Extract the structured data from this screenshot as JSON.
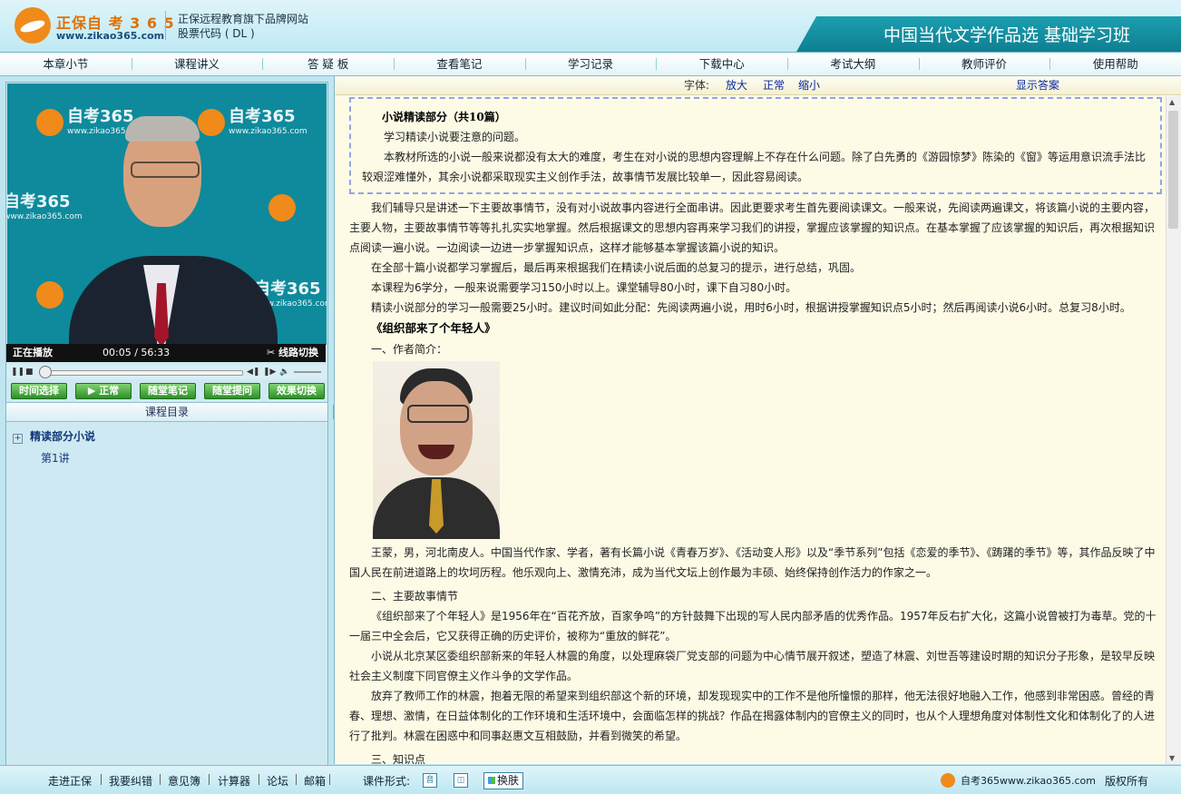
{
  "header": {
    "brand_name": "正保自 考 3 6 5",
    "brand_url": "www.zikao365.com",
    "tagline": "正保远程教育旗下品牌网站",
    "stock_code": "股票代码 ( DL )",
    "course_title": "中国当代文学作品选 基础学习班"
  },
  "nav": {
    "items": [
      "本章小节",
      "课程讲义",
      "答 疑 板",
      "查看笔记",
      "学习记录",
      "下载中心",
      "考试大纲",
      "教师评价",
      "使用帮助"
    ]
  },
  "player": {
    "watermark_text": "自考365",
    "watermark_url": "www.zikao365.com",
    "status": "正在播放",
    "time": "00:05 / 56:33",
    "line_switch": "线路切换",
    "progress": 0.0015
  },
  "player_buttons": [
    "时间选择",
    "▶ 正常",
    "随堂笔记",
    "随堂提问",
    "效果切换"
  ],
  "toc": {
    "header": "课程目录",
    "chapter": "精读部分小说",
    "lesson": "第1讲"
  },
  "fontbar": {
    "label": "字体:",
    "larger": "放大",
    "normal": "正常",
    "smaller": "缩小",
    "show_answer": "显示答案"
  },
  "content": {
    "intro_title": "小说精读部分（共10篇）",
    "intro_lines": [
      "学习精读小说要注意的问题。",
      "本教材所选的小说一般来说都没有太大的难度，考生在对小说的思想内容理解上不存在什么问题。除了白先勇的《游园惊梦》陈染的《窗》等运用意识流手法比较艰涩难懂外，其余小说都采取现实主义创作手法，故事情节发展比较单一，因此容易阅读。"
    ],
    "paragraphs": [
      "我们辅导只是讲述一下主要故事情节，没有对小说故事内容进行全面串讲。因此更要求考生首先要阅读课文。一般来说，先阅读两遍课文，将该篇小说的主要内容，主要人物，主要故事情节等等扎扎实实地掌握。然后根据课文的思想内容再来学习我们的讲授，掌握应该掌握的知识点。在基本掌握了应该掌握的知识后，再次根据知识点阅读一遍小说。一边阅读一边进一步掌握知识点，这样才能够基本掌握该篇小说的知识。",
      "在全部十篇小说都学习掌握后，最后再来根据我们在精读小说后面的总复习的提示，进行总结，巩固。",
      "本课程为6学分，一般来说需要学习150小时以上。课堂辅导80小时，课下自习80小时。",
      "精读小说部分的学习一般需要25小时。建议时间如此分配：先阅读两遍小说，用时6小时，根据讲授掌握知识点5小时；然后再阅读小说6小时。总复习8小时。"
    ],
    "section_title": "《组织部来了个年轻人》",
    "author_heading": "一、作者简介：",
    "author_text": "王蒙，男，河北南皮人。中国当代作家、学者，著有长篇小说《青春万岁》、《活动变人形》以及“季节系列”包括《恋爱的季节》、《踌躇的季节》等，其作品反映了中国人民在前进道路上的坎坷历程。他乐观向上、激情充沛，成为当代文坛上创作最为丰硕、始终保持创作活力的作家之一。",
    "plot_heading": "二、主要故事情节",
    "plot_paragraphs": [
      "《组织部来了个年轻人》是1956年在“百花齐放，百家争鸣”的方针鼓舞下出现的写人民内部矛盾的优秀作品。1957年反右扩大化，这篇小说曾被打为毒草。党的十一届三中全会后，它又获得正确的历史评价，被称为“重放的鲜花”。",
      "小说从北京某区委组织部新来的年轻人林震的角度，以处理麻袋厂党支部的问题为中心情节展开叙述，塑造了林震、刘世吾等建设时期的知识分子形象，是较早反映社会主义制度下同官僚主义作斗争的文学作品。",
      "放弃了教师工作的林震，抱着无限的希望来到组织部这个新的环境，却发现现实中的工作不是他所憧憬的那样，他无法很好地融入工作，他感到非常困惑。曾经的青春、理想、激情，在日益体制化的工作环境和生活环境中，会面临怎样的挑战？作品在揭露体制内的官僚主义的同时，也从个人理想角度对体制性文化和体制化了的人进行了批判。林震在困惑中和同事赵惠文互相鼓励，并看到微笑的希望。"
    ],
    "next_heading": "三、知识点"
  },
  "footer": {
    "links": [
      "走进正保",
      "我要纠错",
      "意见簿",
      "计算器",
      "论坛",
      "邮箱"
    ],
    "course_format": "课件形式:",
    "audio_icon": "音",
    "skin": "换肤",
    "site": "自考365www.zikao365.com",
    "copyright": "版权所有"
  }
}
